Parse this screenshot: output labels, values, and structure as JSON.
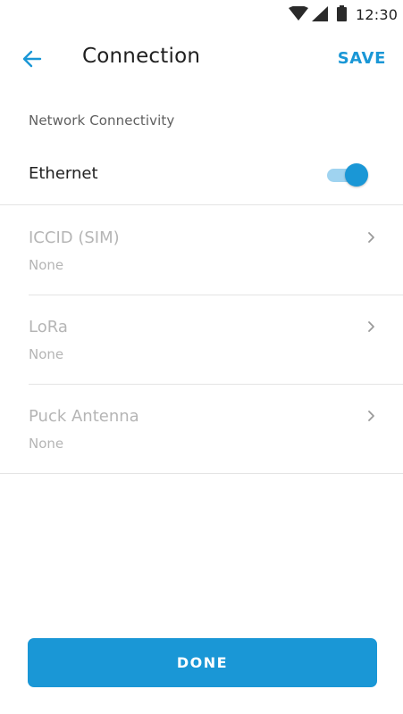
{
  "status_bar": {
    "time": "12:30",
    "icons": [
      "wifi-icon",
      "cell-signal-icon",
      "battery-icon"
    ]
  },
  "app_bar": {
    "title": "Connection",
    "save_label": "SAVE",
    "back_icon": "arrow-left-icon"
  },
  "section": {
    "header": "Network Connectivity"
  },
  "ethernet": {
    "label": "Ethernet",
    "enabled": true
  },
  "items": [
    {
      "label": "ICCID (SIM)",
      "value": "None"
    },
    {
      "label": "LoRa",
      "value": "None"
    },
    {
      "label": "Puck Antenna",
      "value": "None"
    }
  ],
  "done_label": "DONE",
  "colors": {
    "accent": "#1a97d6",
    "accent_light": "#9fd3f0",
    "disabled_text": "#b5b5b5"
  }
}
